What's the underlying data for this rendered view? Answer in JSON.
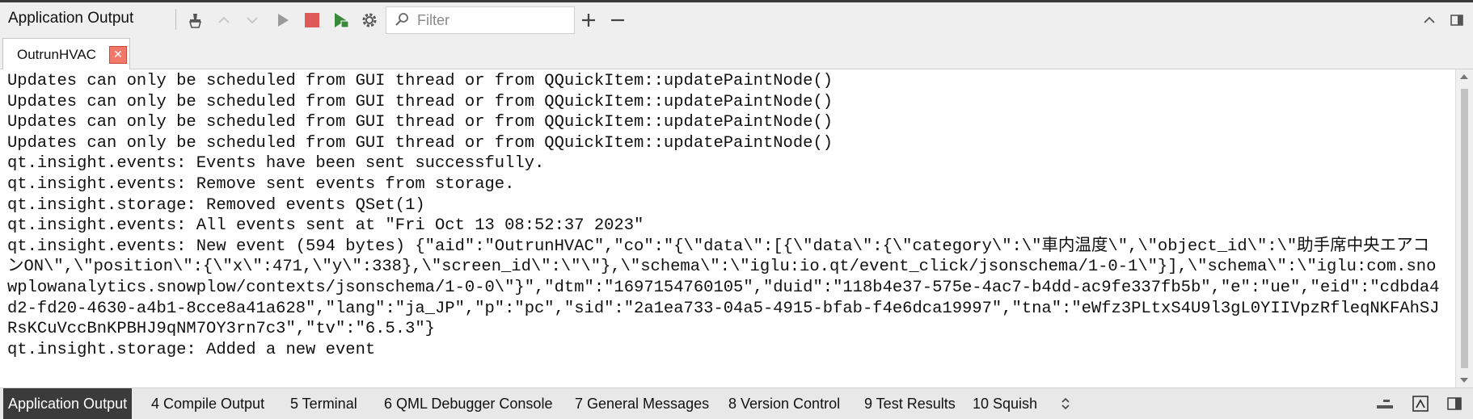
{
  "top_bar": {
    "title": "Application Output",
    "filter_placeholder": "Filter",
    "icons": [
      "clean-icon",
      "previous-icon",
      "next-icon",
      "run-icon",
      "stop-icon",
      "debug-icon",
      "settings-icon",
      "zoom-in-icon",
      "zoom-out-icon",
      "maximize-icon",
      "close-pane-icon"
    ]
  },
  "tab": {
    "label": "OutrunHVAC",
    "close_glyph": "✕"
  },
  "log_lines": [
    "Updates can only be scheduled from GUI thread or from QQuickItem::updatePaintNode()",
    "Updates can only be scheduled from GUI thread or from QQuickItem::updatePaintNode()",
    "Updates can only be scheduled from GUI thread or from QQuickItem::updatePaintNode()",
    "Updates can only be scheduled from GUI thread or from QQuickItem::updatePaintNode()",
    "qt.insight.events: Events have been sent successfully.",
    "qt.insight.events: Remove sent events from storage.",
    "qt.insight.storage: Removed events QSet(1)",
    "qt.insight.events: All events sent at \"Fri Oct 13 08:52:37 2023\"",
    "qt.insight.events: New event (594 bytes) {\"aid\":\"OutrunHVAC\",\"co\":\"{\\\"data\\\":[{\\\"data\\\":{\\\"category\\\":\\\"車内温度\\\",\\\"object_id\\\":\\\"助手席中央エアコンON\\\",\\\"position\\\":{\\\"x\\\":471,\\\"y\\\":338},\\\"screen_id\\\":\\\"\\\"},\\\"schema\\\":\\\"iglu:io.qt/event_click/jsonschema/1-0-1\\\"}],\\\"schema\\\":\\\"iglu:com.snowplowanalytics.snowplow/contexts/jsonschema/1-0-0\\\"}\",\"dtm\":\"1697154760105\",\"duid\":\"118b4e37-575e-4ac7-b4dd-ac9fe337fb5b\",\"e\":\"ue\",\"eid\":\"cdbda4d2-fd20-4630-a4b1-8cce8a41a628\",\"lang\":\"ja_JP\",\"p\":\"pc\",\"sid\":\"2a1ea733-04a5-4915-bfab-f4e6dca19997\",\"tna\":\"eWfz3PLtxS4U9l3gL0YIIVpzRfleqNKFAhSJRsKCuVccBnKPBHJ9qNM7OY3rn7c3\",\"tv\":\"6.5.3\"}",
    "qt.insight.storage: Added a new event"
  ],
  "bottom_panes": [
    {
      "label": "Application Output",
      "active": true
    },
    {
      "label": "4  Compile Output",
      "active": false
    },
    {
      "label": "5  Terminal",
      "active": false
    },
    {
      "label": "6  QML Debugger Console",
      "active": false
    },
    {
      "label": "7  General Messages",
      "active": false
    },
    {
      "label": "8  Version Control",
      "active": false
    },
    {
      "label": "9  Test Results",
      "active": false
    },
    {
      "label": "10  Squish",
      "active": false
    }
  ],
  "colors": {
    "stop": "#e05a5a",
    "run_disabled": "#9a9a9a",
    "debug": "#3b8a3b",
    "active_pane_bg": "#3b3b3b"
  }
}
